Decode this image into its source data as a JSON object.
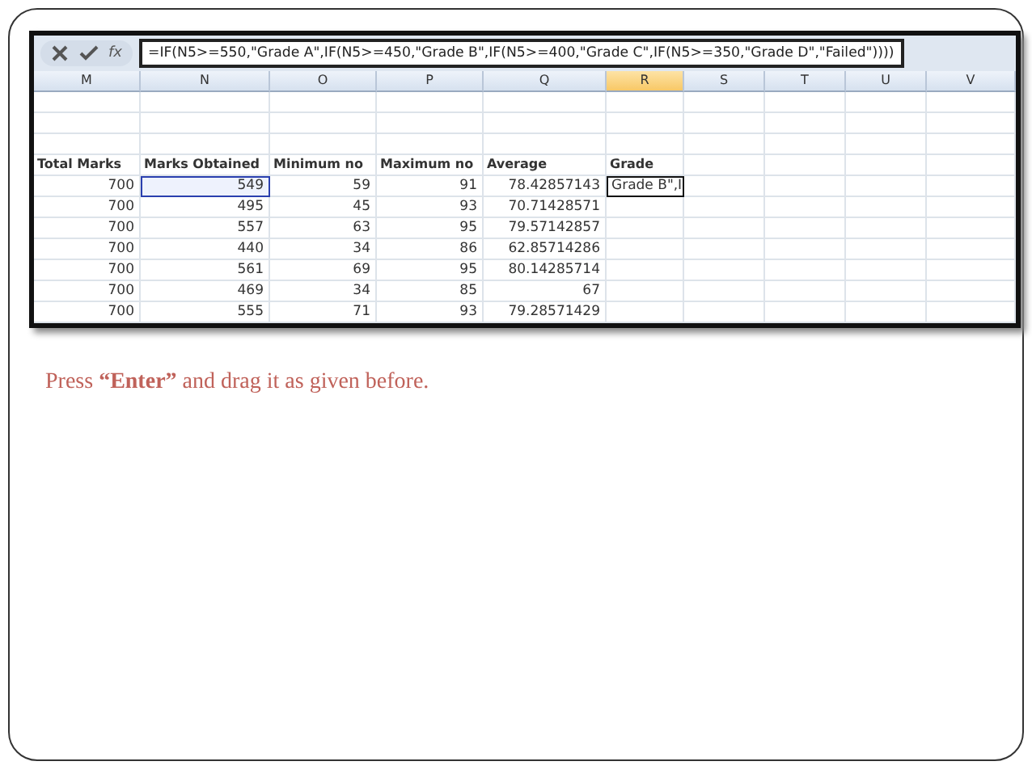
{
  "formula_bar": {
    "function_label": "fx",
    "formula": "=IF(N5>=550,\"Grade A\",IF(N5>=450,\"Grade B\",IF(N5>=400,\"Grade C\",IF(N5>=350,\"Grade D\",\"Failed\"))))"
  },
  "columns": [
    {
      "label": "M",
      "selected": false
    },
    {
      "label": "N",
      "selected": false
    },
    {
      "label": "O",
      "selected": false
    },
    {
      "label": "P",
      "selected": false
    },
    {
      "label": "Q",
      "selected": false
    },
    {
      "label": "R",
      "selected": true
    },
    {
      "label": "S",
      "selected": false
    },
    {
      "label": "T",
      "selected": false
    },
    {
      "label": "U",
      "selected": false
    },
    {
      "label": "V",
      "selected": false
    }
  ],
  "header_row": [
    "Total Marks",
    "Marks Obtained",
    "Minimum no",
    "Maximum no",
    "Average",
    "Grade"
  ],
  "rows": [
    {
      "cells": [
        {
          "text": "700",
          "selected": false,
          "active": false
        },
        {
          "text": "549",
          "selected": true,
          "active": false
        },
        {
          "text": "59",
          "selected": false,
          "active": false
        },
        {
          "text": "91",
          "selected": false,
          "active": false
        },
        {
          "text": "78.42857143",
          "selected": false,
          "active": false
        },
        {
          "text": "Grade B\",I",
          "selected": false,
          "active": true
        }
      ]
    },
    {
      "cells": [
        {
          "text": "700",
          "selected": false,
          "active": false
        },
        {
          "text": "495",
          "selected": false,
          "active": false
        },
        {
          "text": "45",
          "selected": false,
          "active": false
        },
        {
          "text": "93",
          "selected": false,
          "active": false
        },
        {
          "text": "70.71428571",
          "selected": false,
          "active": false
        }
      ]
    },
    {
      "cells": [
        {
          "text": "700",
          "selected": false,
          "active": false
        },
        {
          "text": "557",
          "selected": false,
          "active": false
        },
        {
          "text": "63",
          "selected": false,
          "active": false
        },
        {
          "text": "95",
          "selected": false,
          "active": false
        },
        {
          "text": "79.57142857",
          "selected": false,
          "active": false
        }
      ]
    },
    {
      "cells": [
        {
          "text": "700",
          "selected": false,
          "active": false
        },
        {
          "text": "440",
          "selected": false,
          "active": false
        },
        {
          "text": "34",
          "selected": false,
          "active": false
        },
        {
          "text": "86",
          "selected": false,
          "active": false
        },
        {
          "text": "62.85714286",
          "selected": false,
          "active": false
        }
      ]
    },
    {
      "cells": [
        {
          "text": "700",
          "selected": false,
          "active": false
        },
        {
          "text": "561",
          "selected": false,
          "active": false
        },
        {
          "text": "69",
          "selected": false,
          "active": false
        },
        {
          "text": "95",
          "selected": false,
          "active": false
        },
        {
          "text": "80.14285714",
          "selected": false,
          "active": false
        }
      ]
    },
    {
      "cells": [
        {
          "text": "700",
          "selected": false,
          "active": false
        },
        {
          "text": "469",
          "selected": false,
          "active": false
        },
        {
          "text": "34",
          "selected": false,
          "active": false
        },
        {
          "text": "85",
          "selected": false,
          "active": false
        },
        {
          "text": "67",
          "selected": false,
          "active": false
        }
      ]
    },
    {
      "cells": [
        {
          "text": "700",
          "selected": false,
          "active": false
        },
        {
          "text": "555",
          "selected": false,
          "active": false
        },
        {
          "text": "71",
          "selected": false,
          "active": false
        },
        {
          "text": "93",
          "selected": false,
          "active": false
        },
        {
          "text": "79.28571429",
          "selected": false,
          "active": false
        }
      ]
    }
  ],
  "caption": "Press **“Enter”** and drag it as given before."
}
